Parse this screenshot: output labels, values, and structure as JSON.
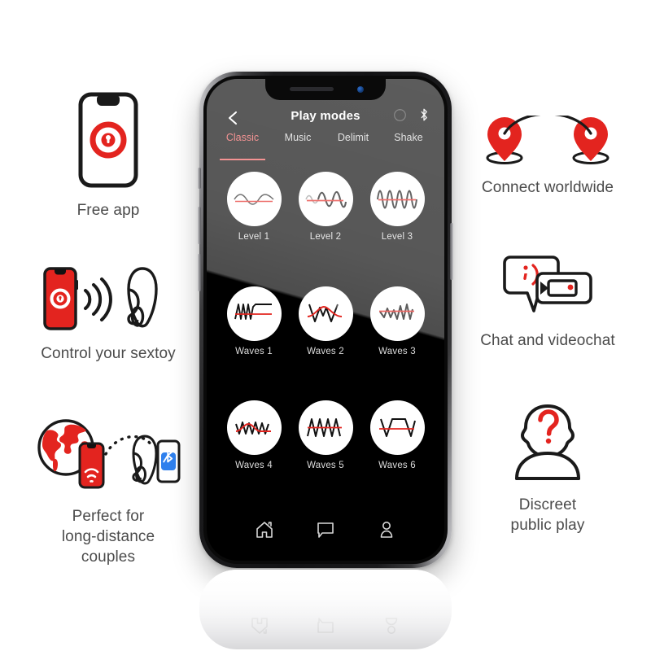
{
  "colors": {
    "brand_red": "#E3241F",
    "accent_pink": "#EF5A5A",
    "caption_gray": "#4B4B4B",
    "bluetooth_blue": "#2F80ED"
  },
  "features_left": [
    {
      "id": "free-app",
      "caption": "Free app",
      "icon": "phone-lock-icon"
    },
    {
      "id": "control",
      "caption": "Control your sextoy",
      "icon": "phone-signal-toy-icon"
    },
    {
      "id": "long-dist",
      "caption": "Perfect for\nlong-distance\ncouples",
      "icon": "globe-phone-toy-bluetooth-icon"
    }
  ],
  "features_right": [
    {
      "id": "connect",
      "caption": "Connect worldwide",
      "icon": "two-map-pins-arc-icon"
    },
    {
      "id": "chat",
      "caption": "Chat and videochat",
      "icon": "speech-bubbles-video-icon"
    },
    {
      "id": "discreet",
      "caption": "Discreet\npublic play",
      "icon": "anonymous-person-question-icon"
    }
  ],
  "phone": {
    "header": {
      "back_icon": "chevron-left-icon",
      "title": "Play modes",
      "right_icons": [
        "compass-icon",
        "bluetooth-icon"
      ]
    },
    "tabs": [
      {
        "label": "Classic",
        "active": true
      },
      {
        "label": "Music",
        "active": false
      },
      {
        "label": "Delimit",
        "active": false
      },
      {
        "label": "Shake",
        "active": false
      }
    ],
    "modes": [
      {
        "label": "Level 1",
        "wave": "sine-low"
      },
      {
        "label": "Level 2",
        "wave": "sine-mid"
      },
      {
        "label": "Level 3",
        "wave": "sine-high"
      },
      {
        "label": "Waves 1",
        "wave": "burst-then-flat"
      },
      {
        "label": "Waves 2",
        "wave": "v-peaks"
      },
      {
        "label": "Waves 3",
        "wave": "zigzag-rising"
      },
      {
        "label": "Waves 4",
        "wave": "zigzag-dense"
      },
      {
        "label": "Waves 5",
        "wave": "saw-triangles"
      },
      {
        "label": "Waves 6",
        "wave": "trapezoid"
      }
    ],
    "tabbar": [
      {
        "icon": "home-icon",
        "name": "home"
      },
      {
        "icon": "chat-icon",
        "name": "chat"
      },
      {
        "icon": "profile-icon",
        "name": "profile"
      }
    ]
  }
}
